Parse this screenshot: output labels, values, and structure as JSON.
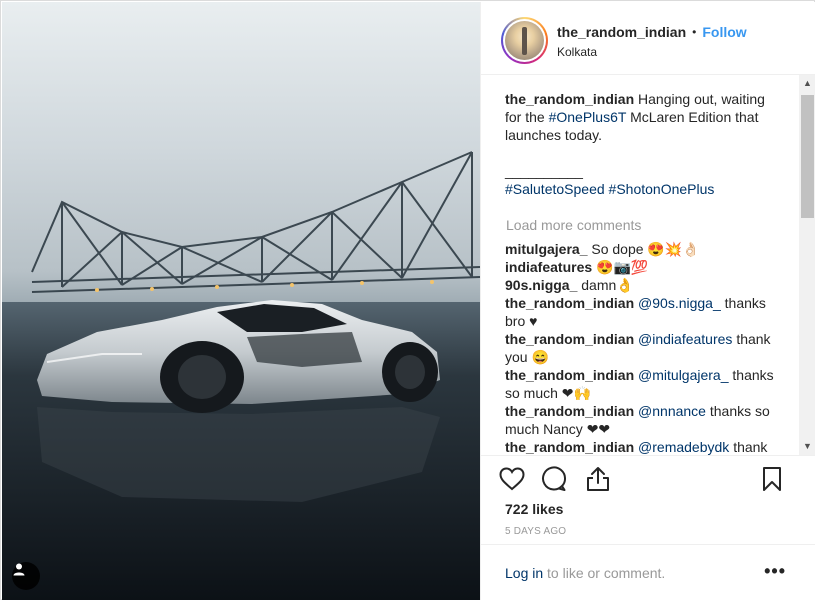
{
  "post": {
    "username": "the_random_indian",
    "follow_label": "Follow",
    "separator": "•",
    "location": "Kolkata",
    "caption_user": "the_random_indian",
    "caption_text": "Hanging out, waiting for the",
    "caption_tag": "#OnePlus6T",
    "caption_rest": "McLaren Edition that launches today.",
    "caption_separator": "__________",
    "hashtag_1": "#SalutetoSpeed",
    "hashtag_2": "#ShotonOnePlus",
    "load_more": "Load more comments",
    "likes": "722 likes",
    "age": "5 DAYS AGO",
    "login_label": "Log in",
    "login_suffix": "to like or comment.",
    "more_label": "•••"
  },
  "comments": [
    {
      "user": "mitulgajera_",
      "pre": "",
      "mention": "",
      "text": "So dope 😍💥👌🏻"
    },
    {
      "user": "indiafeatures",
      "pre": "",
      "mention": "",
      "text": "😍📷💯"
    },
    {
      "user": "90s.nigga_",
      "pre": "",
      "mention": "",
      "text": "damn👌"
    },
    {
      "user": "the_random_indian",
      "pre": "",
      "mention": "@90s.nigga_",
      "text": "thanks bro ♥"
    },
    {
      "user": "the_random_indian",
      "pre": "",
      "mention": "@indiafeatures",
      "text": "thank you 😄"
    },
    {
      "user": "the_random_indian",
      "pre": "",
      "mention": "@mitulgajera_",
      "text": "thanks so much ❤🙌"
    },
    {
      "user": "the_random_indian",
      "pre": "",
      "mention": "@nnnance",
      "text": "thanks so much Nancy ❤❤"
    },
    {
      "user": "the_random_indian",
      "pre": "",
      "mention": "@remadebydk",
      "text": "thank you 😄❤"
    }
  ],
  "icons": {
    "like": "heart-icon",
    "comment": "comment-icon",
    "share": "share-icon",
    "save": "bookmark-icon",
    "user_tag": "user-tag-icon"
  },
  "colors": {
    "link": "#3897f0",
    "tag": "#003569",
    "muted": "#999999"
  }
}
